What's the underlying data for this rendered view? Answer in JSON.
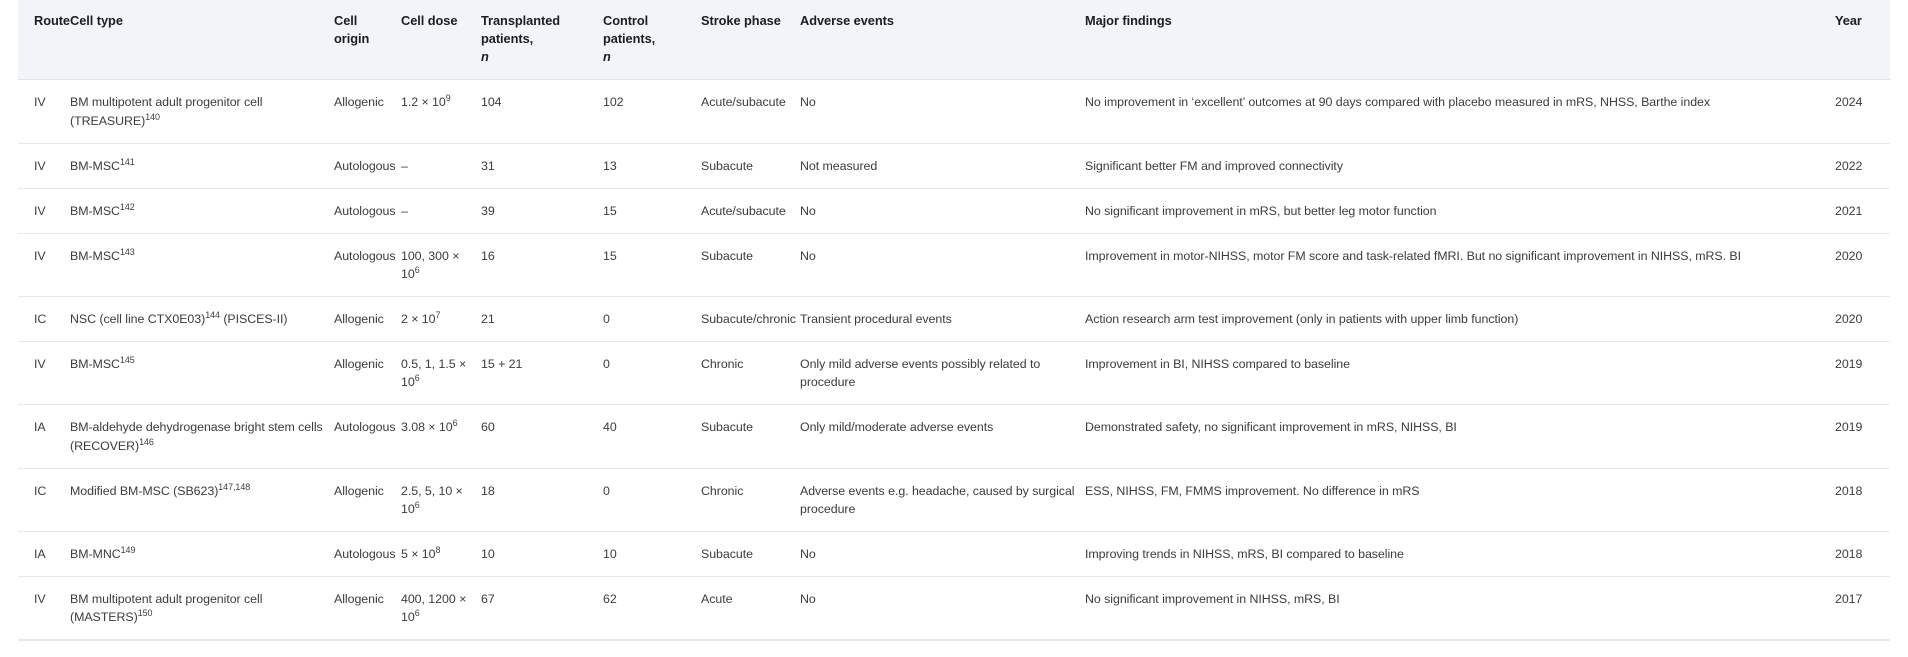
{
  "table": {
    "columns": [
      {
        "key": "route",
        "label": "Route"
      },
      {
        "key": "cell_type",
        "label": "Cell type"
      },
      {
        "key": "origin",
        "label": "Cell origin"
      },
      {
        "key": "dose",
        "label": "Cell dose"
      },
      {
        "key": "transplanted",
        "label": "Transplanted patients,",
        "sub": "n"
      },
      {
        "key": "control",
        "label": "Control patients,",
        "sub": "n"
      },
      {
        "key": "phase",
        "label": "Stroke phase"
      },
      {
        "key": "adverse",
        "label": "Adverse events"
      },
      {
        "key": "findings",
        "label": "Major findings"
      },
      {
        "key": "year",
        "label": "Year"
      }
    ],
    "rows": [
      {
        "route": "IV",
        "cell_type": "BM multipotent adult progenitor cell (TREASURE)",
        "cell_type_ref": "140",
        "origin": "Allogenic",
        "dose_main": "1.2 × 10",
        "dose_exp": "9",
        "dose_tail": "",
        "transplanted": "104",
        "control": "102",
        "phase": "Acute/subacute",
        "adverse": "No",
        "findings": "No improvement in ‘excellent’ outcomes at 90 days compared with placebo measured in mRS, NHSS, Barthe index",
        "year": "2024"
      },
      {
        "route": "IV",
        "cell_type": "BM-MSC",
        "cell_type_ref": "141",
        "origin": "Autologous",
        "dose_main": "–",
        "dose_exp": "",
        "dose_tail": "",
        "transplanted": "31",
        "control": "13",
        "phase": "Subacute",
        "adverse": "Not measured",
        "findings": "Significant better FM and improved connectivity",
        "year": "2022"
      },
      {
        "route": "IV",
        "cell_type": "BM-MSC",
        "cell_type_ref": "142",
        "origin": "Autologous",
        "dose_main": "–",
        "dose_exp": "",
        "dose_tail": "",
        "transplanted": "39",
        "control": "15",
        "phase": "Acute/subacute",
        "adverse": "No",
        "findings": "No significant improvement in mRS, but better leg motor function",
        "year": "2021"
      },
      {
        "route": "IV",
        "cell_type": "BM-MSC",
        "cell_type_ref": "143",
        "origin": "Autologous",
        "dose_main": "100, 300 × 10",
        "dose_exp": "6",
        "dose_tail": "",
        "transplanted": "16",
        "control": "15",
        "phase": "Subacute",
        "adverse": "No",
        "findings": "Improvement in motor-NIHSS, motor FM score and task-related fMRI. But no significant improvement in NIHSS, mRS. BI",
        "year": "2020"
      },
      {
        "route": "IC",
        "cell_type": "NSC (cell line CTX0E03)",
        "cell_type_ref": "144",
        "cell_type_after": " (PISCES-II)",
        "origin": "Allogenic",
        "dose_main": "2 × 10",
        "dose_exp": "7",
        "dose_tail": "",
        "transplanted": "21",
        "control": "0",
        "phase": "Subacute/chronic",
        "adverse": "Transient procedural events",
        "findings": "Action research arm test improvement (only in patients with upper limb function)",
        "year": "2020"
      },
      {
        "route": "IV",
        "cell_type": "BM-MSC",
        "cell_type_ref": "145",
        "origin": "Allogenic",
        "dose_main": "0.5, 1, 1.5 × 10",
        "dose_exp": "6",
        "dose_tail": "",
        "transplanted": "15 + 21",
        "control": "0",
        "phase": "Chronic",
        "adverse": "Only mild adverse events possibly related to procedure",
        "findings": "Improvement in BI, NIHSS compared to baseline",
        "year": "2019"
      },
      {
        "route": "IA",
        "cell_type": "BM-aldehyde dehydrogenase bright stem cells (RECOVER)",
        "cell_type_ref": "146",
        "origin": "Autologous",
        "dose_main": "3.08 × 10",
        "dose_exp": "6",
        "dose_tail": "",
        "transplanted": "60",
        "control": "40",
        "phase": "Subacute",
        "adverse": "Only mild/moderate adverse events",
        "findings": "Demonstrated safety, no significant improvement in mRS, NIHSS, BI",
        "year": "2019"
      },
      {
        "route": "IC",
        "cell_type": "Modified BM-MSC (SB623)",
        "cell_type_ref": "147,148",
        "origin": "Allogenic",
        "dose_main": "2.5, 5, 10 × 10",
        "dose_exp": "6",
        "dose_tail": "",
        "transplanted": "18",
        "control": "0",
        "phase": "Chronic",
        "adverse": "Adverse events e.g. headache, caused by surgical procedure",
        "findings": "ESS, NIHSS, FM, FMMS improvement. No difference in mRS",
        "year": "2018"
      },
      {
        "route": "IA",
        "cell_type": "BM-MNC",
        "cell_type_ref": "149",
        "origin": "Autologous",
        "dose_main": "5 × 10",
        "dose_exp": "8",
        "dose_tail": "",
        "transplanted": "10",
        "control": "10",
        "phase": "Subacute",
        "adverse": "No",
        "findings": "Improving trends in NIHSS, mRS, BI compared to baseline",
        "year": "2018"
      },
      {
        "route": "IV",
        "cell_type": "BM multipotent adult progenitor cell (MASTERS)",
        "cell_type_ref": "150",
        "origin": "Allogenic",
        "dose_main": "400, 1200 × 10",
        "dose_exp": "6",
        "dose_tail": "",
        "transplanted": "67",
        "control": "62",
        "phase": "Acute",
        "adverse": "No",
        "findings": "No significant improvement in NIHSS, mRS, BI",
        "year": "2017"
      }
    ]
  },
  "style": {
    "header_bg": "#f1f4f9",
    "border": "#e6e8ec",
    "text": "#3a3c40",
    "header_text": "#1c1d20"
  }
}
